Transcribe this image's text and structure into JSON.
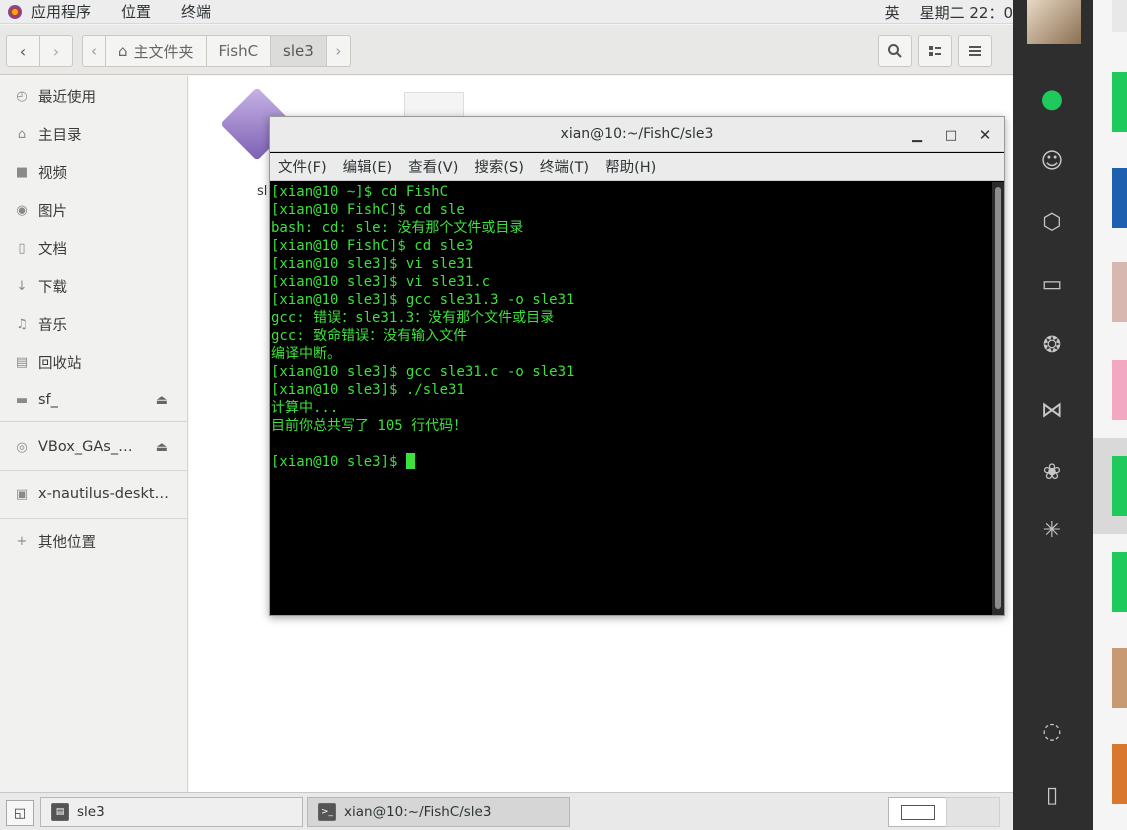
{
  "top_panel": {
    "apps_label": "应用程序",
    "places_label": "位置",
    "terminal_label": "终端",
    "ime_label": "英",
    "clock": "星期二 22：0"
  },
  "nautilus": {
    "breadcrumbs": [
      {
        "label": "主文件夹",
        "icon": "home-icon"
      },
      {
        "label": "FishC"
      },
      {
        "label": "sle3"
      }
    ],
    "sidebar": [
      {
        "icon": "clock-icon",
        "label": "最近使用"
      },
      {
        "icon": "home-icon",
        "label": "主目录"
      },
      {
        "icon": "video-icon",
        "label": "视频"
      },
      {
        "icon": "camera-icon",
        "label": "图片"
      },
      {
        "icon": "document-icon",
        "label": "文档"
      },
      {
        "icon": "download-icon",
        "label": "下载"
      },
      {
        "icon": "music-icon",
        "label": "音乐"
      },
      {
        "icon": "trash-icon",
        "label": "回收站"
      },
      {
        "icon": "drive-icon",
        "label": "sf_"
      },
      {
        "icon": "disc-icon",
        "label": "VBox_GAs_…"
      },
      {
        "icon": "network-folder-icon",
        "label": "x-nautilus-deskt…"
      },
      {
        "icon": "plus-icon",
        "label": "其他位置"
      }
    ],
    "files": [
      {
        "label": "sl"
      }
    ]
  },
  "terminal": {
    "title": "xian@10:~/FishC/sle3",
    "menu": [
      "文件(F)",
      "编辑(E)",
      "查看(V)",
      "搜索(S)",
      "终端(T)",
      "帮助(H)"
    ],
    "lines": [
      "[xian@10 ~]$ cd FishC",
      "[xian@10 FishC]$ cd sle",
      "bash: cd: sle: 没有那个文件或目录",
      "[xian@10 FishC]$ cd sle3",
      "[xian@10 sle3]$ vi sle31",
      "[xian@10 sle3]$ vi sle31.c",
      "[xian@10 sle3]$ gcc sle31.3 -o sle31",
      "gcc: 错误：sle31.3：没有那个文件或目录",
      "gcc: 致命错误：没有输入文件",
      "编译中断。",
      "[xian@10 sle3]$ gcc sle31.c -o sle31",
      "[xian@10 sle3]$ ./sle31",
      "计算中...",
      "目前你总共写了 105 行代码！",
      "",
      "[xian@10 sle3]$ "
    ]
  },
  "taskbar": {
    "tasks": [
      {
        "label": "sle3"
      },
      {
        "label": "xian@10:~/FishC/sle3"
      }
    ]
  },
  "colors": {
    "terminal_fg": "#3ce13c",
    "terminal_bg": "#000000",
    "wechat_green": "#1fc95c",
    "dark_strip": "#2e2e2e"
  }
}
